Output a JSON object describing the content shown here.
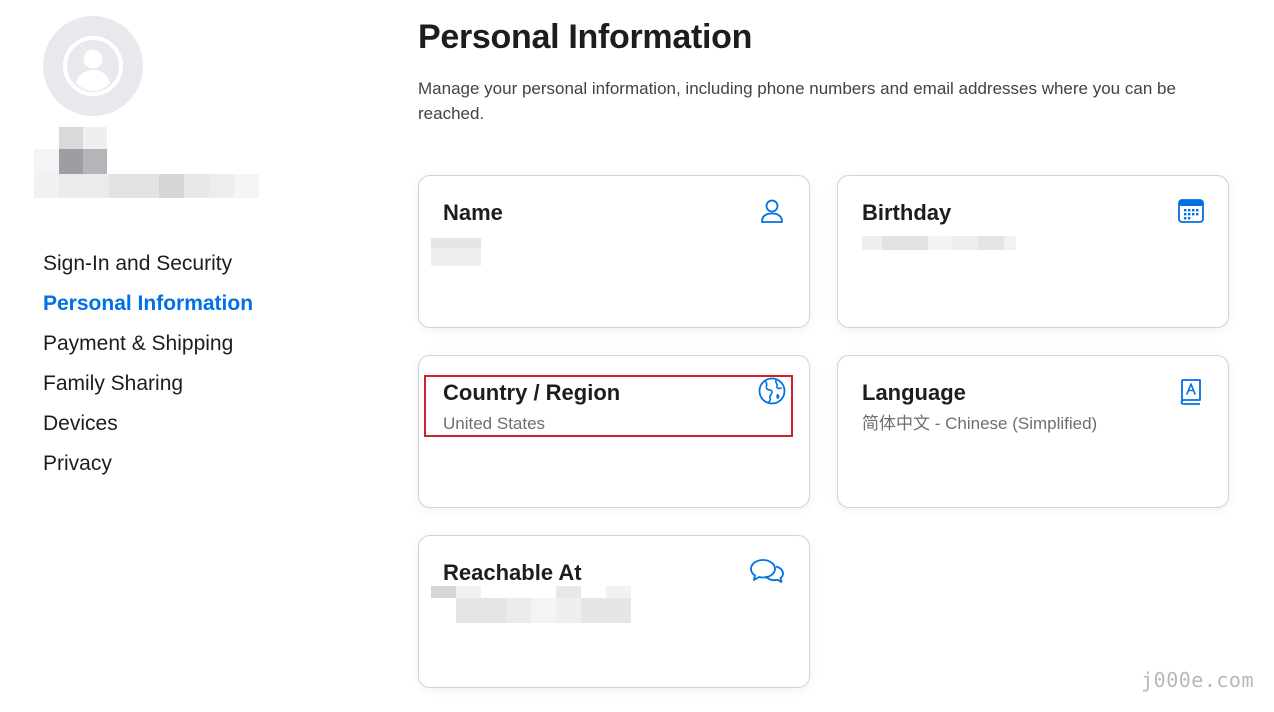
{
  "sidebar": {
    "items": [
      {
        "label": "Sign-In and Security",
        "active": false
      },
      {
        "label": "Personal Information",
        "active": true
      },
      {
        "label": "Payment & Shipping",
        "active": false
      },
      {
        "label": "Family Sharing",
        "active": false
      },
      {
        "label": "Devices",
        "active": false
      },
      {
        "label": "Privacy",
        "active": false
      }
    ]
  },
  "main": {
    "title": "Personal Information",
    "description": "Manage your personal information, including phone numbers and email addresses where you can be reached.",
    "cards": {
      "name": {
        "title": "Name",
        "value": "",
        "icon": "person-icon"
      },
      "birthday": {
        "title": "Birthday",
        "value": "",
        "icon": "calendar-icon"
      },
      "country": {
        "title": "Country / Region",
        "value": "United States",
        "icon": "globe-icon"
      },
      "language": {
        "title": "Language",
        "value": "简体中文 - Chinese (Simplified)",
        "icon": "book-icon"
      },
      "reachable": {
        "title": "Reachable At",
        "value": "",
        "icon": "chat-bubbles-icon"
      }
    }
  },
  "colors": {
    "accent": "#0071e3",
    "highlight_border": "#d0202a",
    "text": "#1d1d1f",
    "secondary_text": "#6e6e73"
  },
  "watermark": "j000e.com"
}
